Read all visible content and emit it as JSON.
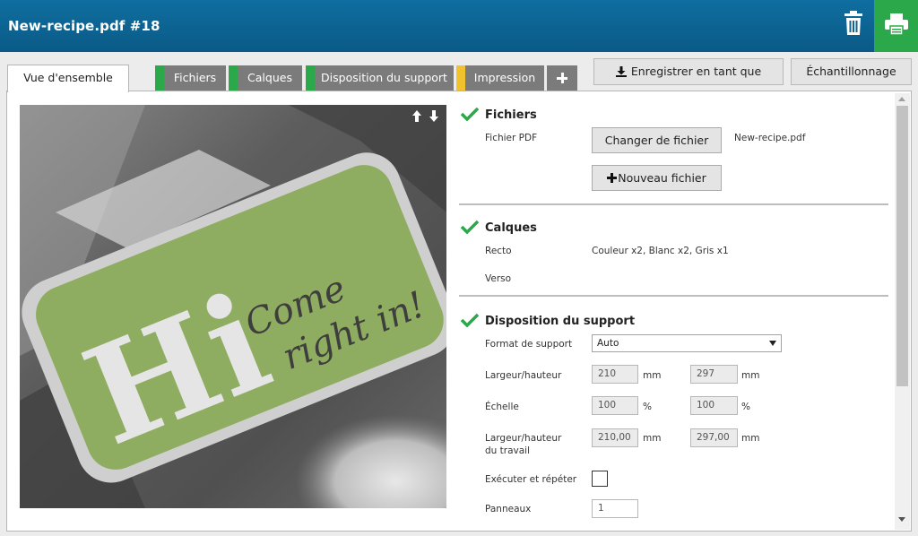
{
  "app": {
    "title": "New-recipe.pdf #18"
  },
  "header": {
    "delete_icon": "trash-icon",
    "print_icon": "printer-icon",
    "print_color": "#2ba84a"
  },
  "tabs": [
    {
      "label": "Vue d'ensemble",
      "active": true
    },
    {
      "label": "Fichiers",
      "status_color": "#2ba84a"
    },
    {
      "label": "Calques",
      "status_color": "#2ba84a"
    },
    {
      "label": "Disposition du support",
      "status_color": "#2ba84a"
    },
    {
      "label": "Impression",
      "status_color": "#f2c12e"
    }
  ],
  "toolbar": {
    "save_recipe_label": "Enregistrer en tant que recette",
    "sampling_label": "Échantillonnage"
  },
  "preview": {
    "sign_text": "Hi",
    "script_line1": "Come",
    "script_line2": "right in!",
    "sign_color": "#8fad60"
  },
  "sections": {
    "files": {
      "title": "Fichiers",
      "pdf_label": "Fichier PDF",
      "change_button": "Changer de fichier",
      "file_name": "New-recipe.pdf",
      "new_button": "Nouveau fichier"
    },
    "layers": {
      "title": "Calques",
      "recto_label": "Recto",
      "recto_value": "Couleur x2, Blanc x2, Gris x1",
      "verso_label": "Verso"
    },
    "layout": {
      "title": "Disposition du support",
      "format_label": "Format de support",
      "format_value": "Auto",
      "size_label": "Largeur/hauteur",
      "width": "210",
      "height": "297",
      "unit_mm": "mm",
      "scale_label": "Échelle",
      "scale_x": "100",
      "scale_y": "100",
      "unit_pct": "%",
      "job_size_label_1": "Largeur/hauteur",
      "job_size_label_2": "du travail",
      "job_width": "210,00",
      "job_height": "297,00",
      "step_repeat_label": "Exécuter et répéter",
      "panels_label": "Panneaux",
      "panels_value": "1"
    }
  }
}
